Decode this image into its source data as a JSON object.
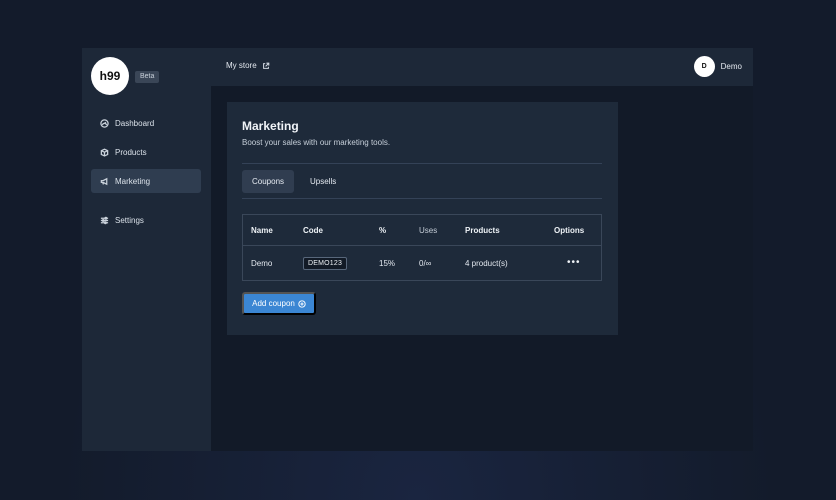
{
  "sidebar": {
    "logo_text": "h99",
    "badge": "Beta",
    "items": [
      {
        "label": "Dashboard",
        "icon": "dashboard-icon"
      },
      {
        "label": "Products",
        "icon": "box-icon"
      },
      {
        "label": "Marketing",
        "icon": "megaphone-icon",
        "active": true
      },
      {
        "label": "Settings",
        "icon": "sliders-icon"
      }
    ]
  },
  "topbar": {
    "store_link": "My store",
    "store_icon": "external-link-icon",
    "user_initial": "D",
    "user_name": "Demo"
  },
  "marketing": {
    "title": "Marketing",
    "subtitle": "Boost your sales with our marketing tools.",
    "tabs": [
      {
        "label": "Coupons",
        "active": true
      },
      {
        "label": "Upsells"
      }
    ],
    "table": {
      "headers": {
        "name": "Name",
        "code": "Code",
        "percent": "%",
        "uses": "Uses",
        "products": "Products",
        "options": "Options"
      },
      "rows": [
        {
          "name": "Demo",
          "code": "DEMO123",
          "percent": "15%",
          "uses": "0/∞",
          "products": "4 product(s)",
          "options": "•••"
        }
      ]
    },
    "add_button": "Add coupon"
  },
  "colors": {
    "accent": "#3b86d3",
    "sidebar_bg": "#1d2838",
    "card_bg": "#1e2a3a",
    "page_bg": "#121a28"
  }
}
